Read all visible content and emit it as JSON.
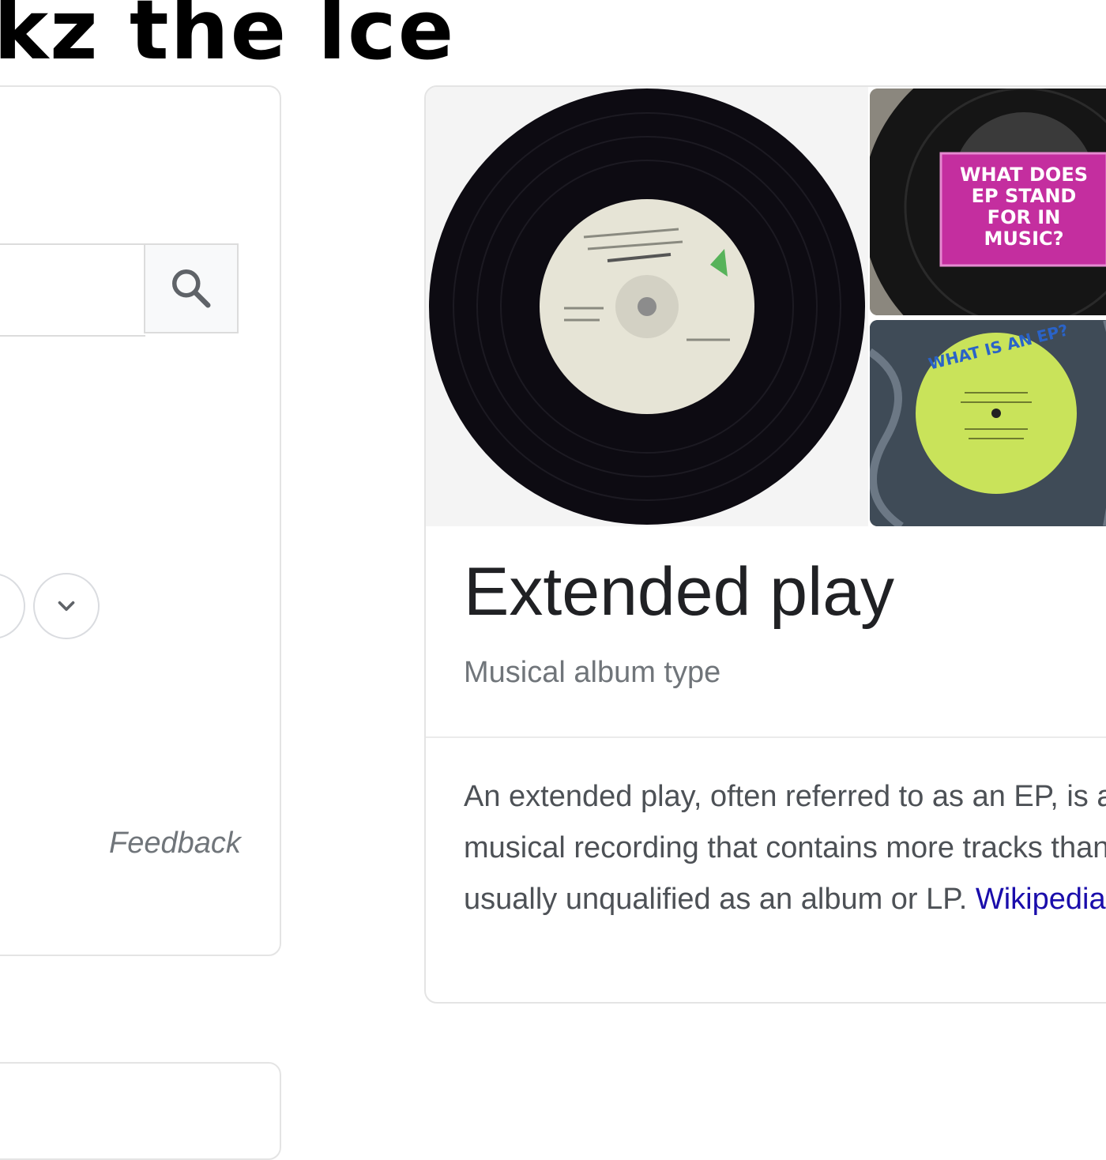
{
  "watermark": {
    "text": "kz the lce"
  },
  "left_panel": {
    "search_icon": "search-icon",
    "expand_icon": "chevron-down-icon",
    "feedback": "Feedback"
  },
  "knowledge_panel": {
    "title": "Extended play",
    "subtitle": "Musical album type",
    "description_lines": [
      "An extended play, often referred to as an EP, is a",
      "musical recording that contains more tracks than a",
      "usually unqualified as an album or LP."
    ],
    "source_link": "Wikipedia",
    "images": {
      "top_right_text": [
        "WHAT DOES",
        "EP STAND",
        "FOR IN",
        "MUSIC?"
      ],
      "bottom_right_text": "WHAT IS AN EP?"
    }
  },
  "colors": {
    "accent_magenta": "#c42e9f",
    "label_green": "#c9e35a",
    "link_blue": "#1a0dab"
  }
}
